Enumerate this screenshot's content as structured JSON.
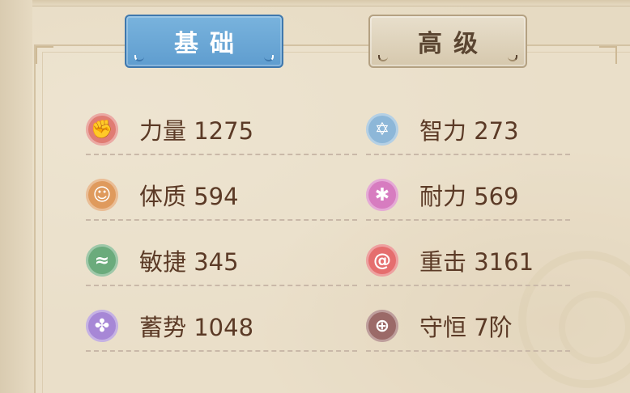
{
  "tabs": {
    "basic": "基础",
    "advanced": "高级"
  },
  "stats": [
    {
      "label": "力量",
      "value": "1275",
      "icon": "strength-fist-icon",
      "color": "#e07c73"
    },
    {
      "label": "智力",
      "value": "273",
      "icon": "intellect-star-icon",
      "color": "#8db7d8"
    },
    {
      "label": "体质",
      "value": "594",
      "icon": "constitution-body-icon",
      "color": "#df9a5d"
    },
    {
      "label": "耐力",
      "value": "569",
      "icon": "endurance-figure-icon",
      "color": "#d77cc0"
    },
    {
      "label": "敏捷",
      "value": "345",
      "icon": "agility-wind-icon",
      "color": "#6bab7c"
    },
    {
      "label": "重击",
      "value": "3161",
      "icon": "critical-swirl-icon",
      "color": "#e56e6e"
    },
    {
      "label": "蓄势",
      "value": "1048",
      "icon": "charge-triskelion-icon",
      "color": "#a787d6"
    },
    {
      "label": "守恒",
      "value": "7阶",
      "icon": "guard-shield-icon",
      "color": "#9b6a68"
    }
  ]
}
